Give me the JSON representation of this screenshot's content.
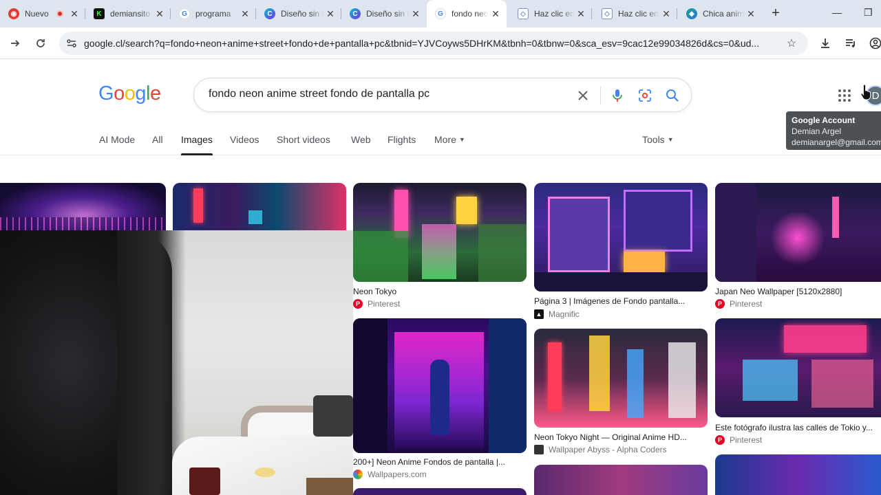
{
  "browser": {
    "tabs": [
      {
        "title": "Nuevo",
        "favicon": "record-icon",
        "color": "#e53935"
      },
      {
        "title": "demiansito",
        "favicon": "k-icon",
        "color": "#111111"
      },
      {
        "title": "programa",
        "favicon": "google-icon",
        "color": "#4285f4"
      },
      {
        "title": "Diseño sin título",
        "favicon": "canva-icon",
        "color": "#00c4cc"
      },
      {
        "title": "Diseño sin título",
        "favicon": "canva-icon",
        "color": "#00c4cc"
      },
      {
        "title": "fondo neon",
        "favicon": "google-icon",
        "color": "#4285f4",
        "active": true
      },
      {
        "title": "Haz clic en",
        "favicon": "cube-icon",
        "color": "#7b8fd6"
      },
      {
        "title": "Haz clic en",
        "favicon": "cube-icon",
        "color": "#7b8fd6"
      },
      {
        "title": "Chica anime",
        "favicon": "copilot-icon",
        "color": "#13a88a"
      }
    ],
    "url": "google.cl/search?q=fondo+neon+anime+street+fondo+de+pantalla+pc&tbnid=YJVCoyws5DHrKM&tbnh=0&tbnw=0&sca_esv=9cac12e99034826d&cs=0&ud..."
  },
  "google": {
    "logo_text": "Google",
    "query": "fondo neon anime street fondo de pantalla pc",
    "nav_tabs": [
      "AI Mode",
      "All",
      "Images",
      "Videos",
      "Short videos",
      "Web",
      "Flights",
      "More"
    ],
    "active_tab": "Images",
    "tools_label": "Tools",
    "avatar_letter": "D",
    "tooltip": {
      "title": "Google Account",
      "name": "Demian Argel",
      "email": "demianargel@gmail.com"
    }
  },
  "results": [
    {
      "title": "Neon Tokyo",
      "source": "Pinterest"
    },
    {
      "title": "Página 3 | Imágenes de Fondo pantalla...",
      "source": "Magnific"
    },
    {
      "title": "Japan Neo Wallpaper [5120x2880]",
      "source": "Pinterest"
    },
    {
      "title": "200+] Neon Anime Fondos de pantalla |...",
      "source": "Wallpapers.com"
    },
    {
      "title": "Neon Tokyo Night — Original Anime HD...",
      "source": "Wallpaper Abyss - Alpha Coders"
    },
    {
      "title": "Este fotógrafo ilustra las calles de Tokio y...",
      "source": "Pinterest"
    }
  ]
}
